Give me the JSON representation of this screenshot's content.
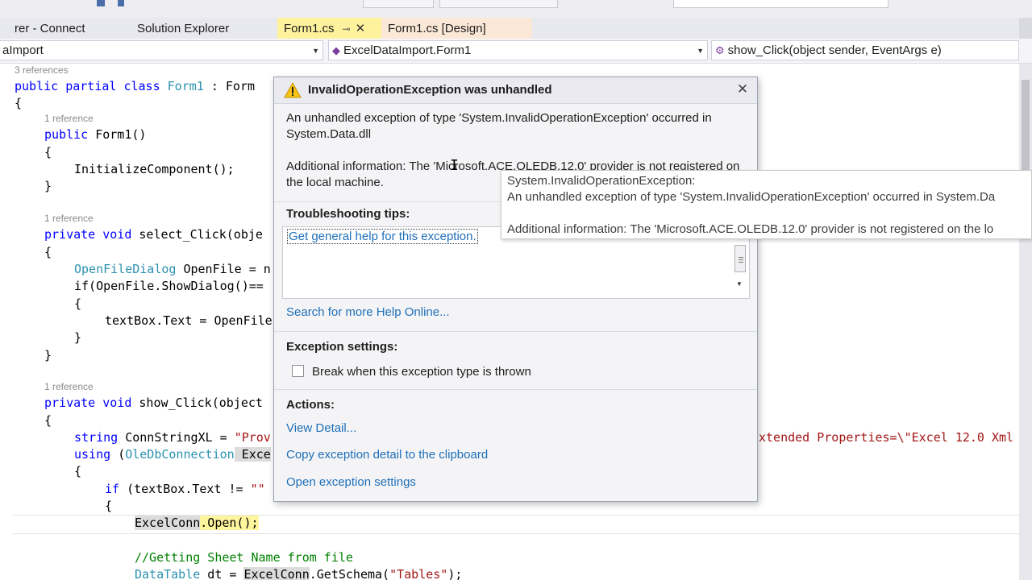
{
  "tabs": {
    "server_explorer": "rer - Connect",
    "solution_explorer": "Solution Explorer",
    "form1_cs": "Form1.cs",
    "form1_design": "Form1.cs [Design]"
  },
  "navbar": {
    "project": "aImport",
    "class": "ExcelDataImport.Form1",
    "member": "show_Click(object sender, EventArgs e)"
  },
  "code": {
    "lens_3refs": "3 references",
    "class_decl": {
      "kw": "public partial class ",
      "name": "Form1",
      "rest": " : Form"
    },
    "brace_open": "{",
    "lens_1ref_a": "1 reference",
    "ctor": {
      "kw": "public ",
      "rest": "Form1()"
    },
    "ctor_open": "{",
    "init": "InitializeComponent();",
    "ctor_close": "}",
    "lens_1ref_b": "1 reference",
    "select_decl": {
      "kw": "private void ",
      "rest": "select_Click(obje"
    },
    "select_open": "{",
    "openfile_decl": {
      "type": "OpenFileDialog",
      "rest": " OpenFile = n"
    },
    "if_show": "if(OpenFile.ShowDialog()==",
    "if_open": "{",
    "textbox_assign": "textBox.Text = OpenFile",
    "if_close": "}",
    "select_close": "}",
    "lens_1ref_c": "1 reference",
    "show_decl": {
      "kw": "private void ",
      "rest": "show_Click(object"
    },
    "show_open": "{",
    "connstr": {
      "kw": "string ",
      "rest": "ConnStringXL = ",
      "str": "\"Prov"
    },
    "connstr_tail": "xtended Properties=\\\"Excel 12.0 Xml",
    "using_line": {
      "kw": "using ",
      "type_open": "(",
      "type": "OleDbConnection",
      "rest": " Exce"
    },
    "using_open": "{",
    "if_text": {
      "kw": "if ",
      "rest": "(textBox.Text != ",
      "str": "\"\""
    },
    "inner_open": "{",
    "excel_open": {
      "obj": "ExcelConn",
      "method": ".Open();"
    },
    "comment": "//Getting Sheet Name from file",
    "datatable": {
      "type": "DataTable",
      "rest1": " dt = ",
      "obj": "ExcelConn",
      "rest2": ".GetSchema(",
      "str": "\"Tables\"",
      "rest3": ");"
    }
  },
  "exception_dialog": {
    "title": "InvalidOperationException was unhandled",
    "message": "An unhandled exception of type 'System.InvalidOperationException' occurred in System.Data.dll",
    "additional_info": "Additional information: The 'Microsoft.ACE.OLEDB.12.0' provider is not registered on the local machine.",
    "troubleshooting_heading": "Troubleshooting tips:",
    "tip_link": "Get general help for this exception.",
    "search_link": "Search for more Help Online...",
    "settings_heading": "Exception settings:",
    "break_checkbox_label": "Break when this exception type is thrown",
    "break_checked": false,
    "actions_heading": "Actions:",
    "view_detail": "View Detail...",
    "copy_detail": "Copy exception detail to the clipboard",
    "open_settings": "Open exception settings"
  },
  "tooltip": {
    "line1": "System.InvalidOperationException:",
    "line2": "An unhandled exception of type 'System.InvalidOperationException' occurred in System.Da",
    "line3": "Additional information: The 'Microsoft.ACE.OLEDB.12.0' provider is not registered on the lo"
  },
  "colors": {
    "keyword": "#0000ff",
    "type": "#2b91af",
    "string": "#a31515",
    "comment": "#008000",
    "link": "#1e6fb8",
    "active_tab": "#fff29d"
  }
}
